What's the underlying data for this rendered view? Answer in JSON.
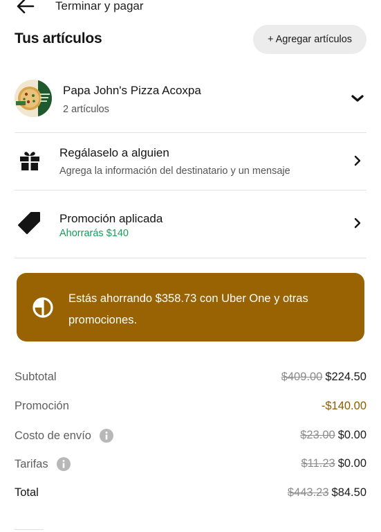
{
  "header": {
    "title": "Terminar y pagar"
  },
  "items_section": {
    "title": "Tus artículos",
    "add_label": "+ Agregar artículos"
  },
  "store": {
    "name": "Papa John's Pizza Acoxpa",
    "count": "2 artículos"
  },
  "gift": {
    "title": "Regálaselo a alguien",
    "subtitle": "Agrega la información del destinatario y un mensaje"
  },
  "promo": {
    "title": "Promoción aplicada",
    "subtitle": "Ahorrarás $140"
  },
  "banner": {
    "text": "Estás ahorrando $358.73 con Uber One y otras promociones."
  },
  "summary": {
    "subtotal": {
      "label": "Subtotal",
      "old": "$409.00",
      "value": "$224.50"
    },
    "promotion": {
      "label": "Promoción",
      "value": "-$140.00"
    },
    "delivery": {
      "label": "Costo de envío",
      "old": "$23.00",
      "value": "$0.00"
    },
    "fees": {
      "label": "Tarifas",
      "old": "$11.23",
      "value": "$0.00"
    },
    "total": {
      "label": "Total",
      "old": "$443.23",
      "value": "$84.50"
    }
  },
  "colors": {
    "banner": "#996303",
    "promo_green": "#199a5a",
    "promo_amount": "#8a5b00"
  },
  "icons": [
    "back-arrow-icon",
    "chevron-down-icon",
    "gift-icon",
    "tag-icon",
    "chevron-right-icon",
    "uber-one-icon",
    "info-icon"
  ]
}
